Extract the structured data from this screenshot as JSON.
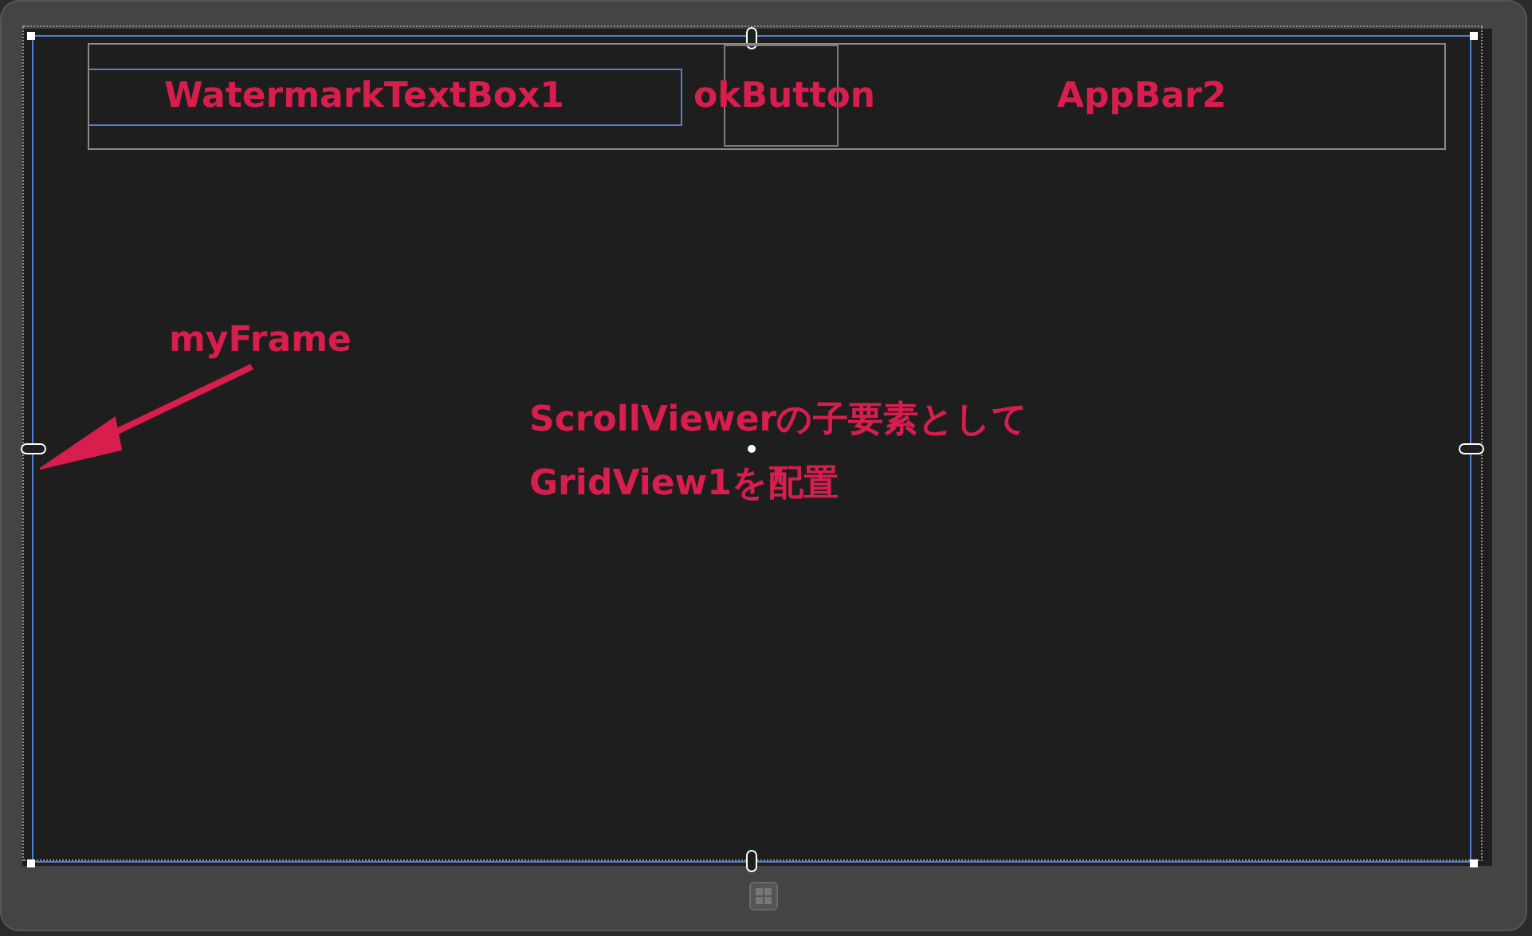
{
  "controls": [
    {
      "kind": "textbox",
      "label": "WatermarkTextBox1"
    },
    {
      "kind": "button",
      "label": "okButton"
    },
    {
      "kind": "appbar",
      "label": "AppBar2"
    }
  ],
  "annotations": [
    {
      "kind": "arrow",
      "text": "myFrame"
    },
    {
      "kind": "note",
      "text": "ScrollViewerの子要素として"
    },
    {
      "kind": "note",
      "text": "GridView1を配置"
    }
  ]
}
